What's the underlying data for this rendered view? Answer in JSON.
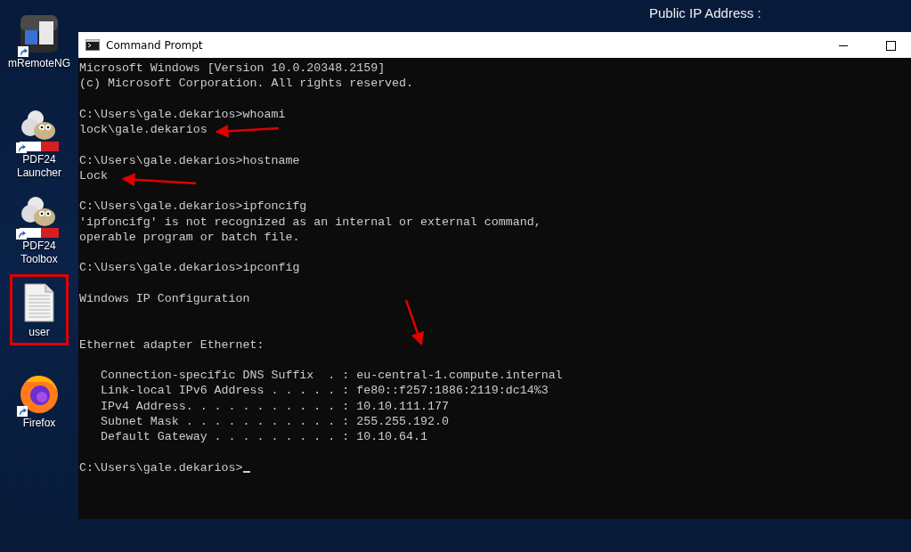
{
  "desktop": {
    "icons": [
      {
        "kind": "mremoteng",
        "label": "mRemoteNG",
        "shortcut": true,
        "highlighted": false
      },
      {
        "kind": "pdf24",
        "label": "PDF24\nLauncher",
        "shortcut": true,
        "highlighted": false
      },
      {
        "kind": "pdf24",
        "label": "PDF24\nToolbox",
        "shortcut": true,
        "highlighted": false
      },
      {
        "kind": "document",
        "label": "user",
        "shortcut": false,
        "highlighted": true
      },
      {
        "kind": "firefox",
        "label": "Firefox",
        "shortcut": true,
        "highlighted": false
      }
    ],
    "wallpaper_text": "Public IP Address :"
  },
  "window": {
    "title": "Command Prompt",
    "lines": [
      {
        "kind": "output",
        "text": "Microsoft Windows [Version 10.0.20348.2159]"
      },
      {
        "kind": "output",
        "text": "(c) Microsoft Corporation. All rights reserved."
      },
      {
        "kind": "blank"
      },
      {
        "kind": "prompt",
        "prompt": "C:\\Users\\gale.dekarios>",
        "command": "whoami"
      },
      {
        "kind": "output",
        "text": "lock\\gale.dekarios"
      },
      {
        "kind": "blank"
      },
      {
        "kind": "prompt",
        "prompt": "C:\\Users\\gale.dekarios>",
        "command": "hostname"
      },
      {
        "kind": "output",
        "text": "Lock"
      },
      {
        "kind": "blank"
      },
      {
        "kind": "prompt",
        "prompt": "C:\\Users\\gale.dekarios>",
        "command": "ipfoncifg"
      },
      {
        "kind": "output",
        "text": "'ipfoncifg' is not recognized as an internal or external command,"
      },
      {
        "kind": "output",
        "text": "operable program or batch file."
      },
      {
        "kind": "blank"
      },
      {
        "kind": "prompt",
        "prompt": "C:\\Users\\gale.dekarios>",
        "command": "ipconfig"
      },
      {
        "kind": "blank"
      },
      {
        "kind": "output",
        "text": "Windows IP Configuration"
      },
      {
        "kind": "blank"
      },
      {
        "kind": "blank"
      },
      {
        "kind": "output",
        "text": "Ethernet adapter Ethernet:"
      },
      {
        "kind": "blank"
      },
      {
        "kind": "output",
        "text": "   Connection-specific DNS Suffix  . : eu-central-1.compute.internal"
      },
      {
        "kind": "output",
        "text": "   Link-local IPv6 Address . . . . . : fe80::f257:1886:2119:dc14%3"
      },
      {
        "kind": "output",
        "text": "   IPv4 Address. . . . . . . . . . . : 10.10.111.177"
      },
      {
        "kind": "output",
        "text": "   Subnet Mask . . . . . . . . . . . : 255.255.192.0"
      },
      {
        "kind": "output",
        "text": "   Default Gateway . . . . . . . . . : 10.10.64.1"
      },
      {
        "kind": "blank"
      },
      {
        "kind": "prompt",
        "prompt": "C:\\Users\\gale.dekarios>",
        "cursor": true
      }
    ]
  }
}
